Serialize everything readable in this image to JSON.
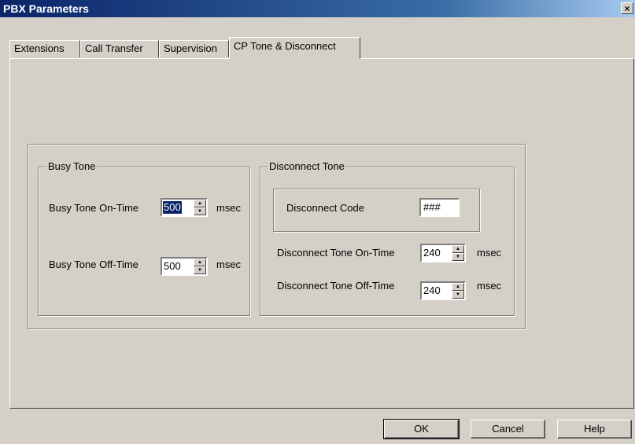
{
  "window": {
    "title": "PBX Parameters",
    "close_glyph": "×"
  },
  "tabs": [
    {
      "label": "Extensions"
    },
    {
      "label": "Call Transfer"
    },
    {
      "label": "Supervision"
    },
    {
      "label": "CP Tone & Disconnect",
      "active": true
    }
  ],
  "busy_tone": {
    "legend": "Busy Tone",
    "on_time": {
      "label": "Busy Tone On-Time",
      "value": "500",
      "unit": "msec"
    },
    "off_time": {
      "label": "Busy Tone Off-Time",
      "value": "500",
      "unit": "msec"
    }
  },
  "disconnect_tone": {
    "legend": "Disconnect Tone",
    "code": {
      "label": "Disconnect Code",
      "value": "###"
    },
    "on_time": {
      "label": "Disconnect Tone On-Time",
      "value": "240",
      "unit": "msec"
    },
    "off_time": {
      "label": "Disconnect Tone Off-Time",
      "value": "240",
      "unit": "msec"
    }
  },
  "buttons": {
    "ok": "OK",
    "cancel": "Cancel",
    "help": "Help"
  },
  "icons": {
    "spin_up": "up-arrow-icon",
    "spin_down": "down-arrow-icon"
  }
}
